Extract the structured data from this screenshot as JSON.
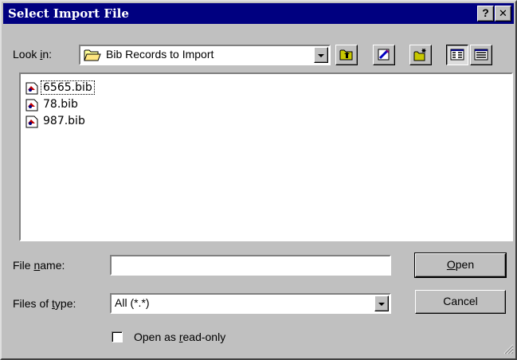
{
  "window": {
    "title": "Select Import File",
    "help_label": "?",
    "close_label": "✕"
  },
  "look_in": {
    "label_pre": "Look ",
    "label_accel": "i",
    "label_post": "n:",
    "value": "Bib Records to Import"
  },
  "toolbar": {
    "up_one_level": "up-folder-icon",
    "desktop": "desktop-icon",
    "new_folder": "new-folder-icon",
    "list_view": "list-view-icon",
    "details_view": "details-view-icon"
  },
  "files": [
    {
      "name": "6565.bib",
      "focused": true
    },
    {
      "name": "78.bib",
      "focused": false
    },
    {
      "name": "987.bib",
      "focused": false
    }
  ],
  "file_name": {
    "label_pre": "File ",
    "label_accel": "n",
    "label_post": "ame:",
    "value": ""
  },
  "file_type": {
    "label_pre": "Files of ",
    "label_accel": "t",
    "label_post": "ype:",
    "value": "All (*.*)"
  },
  "buttons": {
    "open_accel": "O",
    "open_rest": "pen",
    "cancel": "Cancel"
  },
  "readonly": {
    "label_pre": "Open as ",
    "label_accel": "r",
    "label_post": "ead-only",
    "checked": false
  },
  "colors": {
    "titlebar": "#000080",
    "face": "#c0c0c0"
  }
}
